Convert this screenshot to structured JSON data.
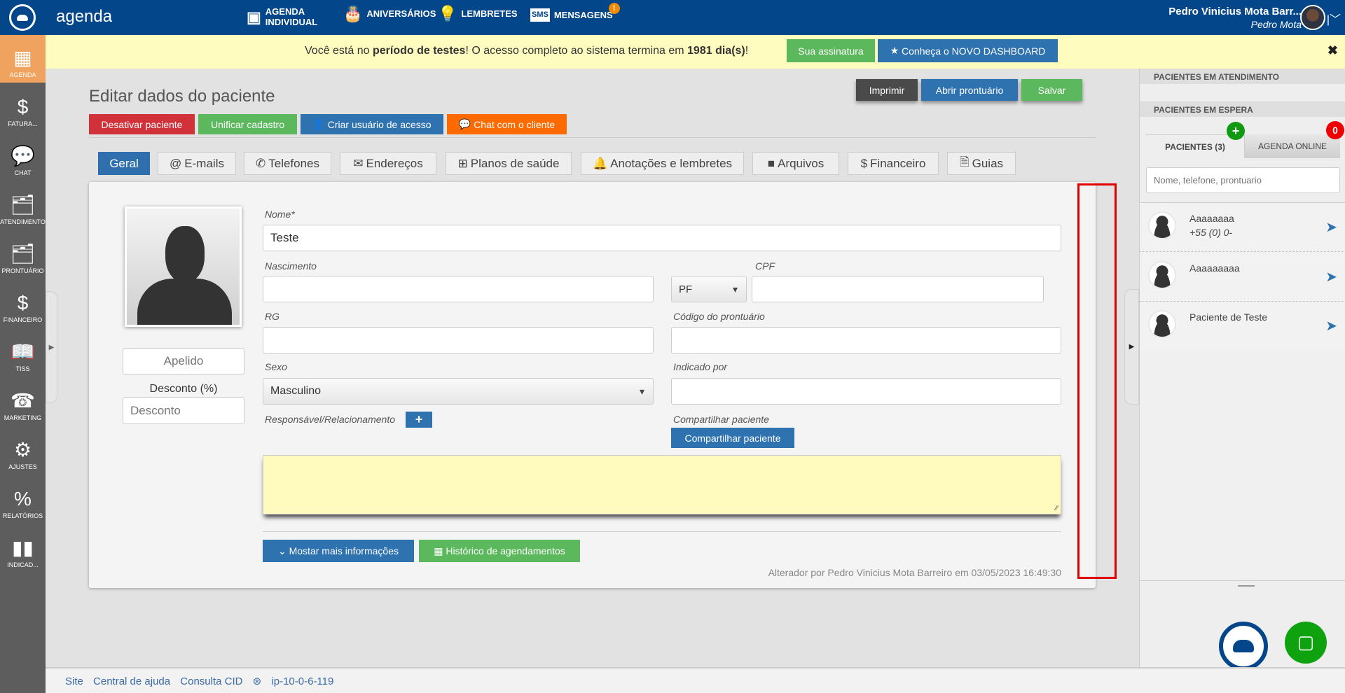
{
  "header": {
    "app_name": "agenda",
    "nav": [
      {
        "label": "AGENDA\nINDIVIDUAL",
        "icon": "calendar-card-icon"
      },
      {
        "label": "ANIVERSÁRIOS",
        "icon": "cake-icon"
      },
      {
        "label": "LEMBRETES",
        "icon": "lightbulb-icon"
      },
      {
        "label": "MENSAGENS",
        "icon": "sms-icon",
        "badge": "!"
      }
    ],
    "user_name": "Pedro Vinicius Mota Barr...",
    "user_short": "Pedro Mota"
  },
  "sidebar": {
    "items": [
      {
        "label": "AGENDA",
        "icon": "calendar-icon",
        "active": true
      },
      {
        "label": "FATURA...",
        "icon": "invoice-icon"
      },
      {
        "label": "CHAT",
        "icon": "chat-icon"
      },
      {
        "label": "ATENDIMENTO",
        "icon": "folder-check-icon"
      },
      {
        "label": "PRONTUÁRIO",
        "icon": "folder-check-icon"
      },
      {
        "label": "FINANCEIRO",
        "icon": "dollar-doc-icon"
      },
      {
        "label": "TISS",
        "icon": "book-icon"
      },
      {
        "label": "MARKETING",
        "icon": "phone-book-icon"
      },
      {
        "label": "AJUSTES",
        "icon": "gears-icon"
      },
      {
        "label": "RELATÓRIOS",
        "icon": "percent-doc-icon"
      },
      {
        "label": "INDICAD...",
        "icon": "bar-chart-icon"
      }
    ]
  },
  "banner": {
    "pre": "Você está no ",
    "bold1": "período de testes",
    "mid": "! O acesso completo ao sistema termina em ",
    "bold2": "1981 dia(s)",
    "post": "!",
    "subscription": "Sua assinatura",
    "dashboard": "Conheça o NOVO DASHBOARD"
  },
  "page": {
    "title": "Editar dados do paciente",
    "actions": {
      "deactivate": "Desativar paciente",
      "merge": "Unificar cadastro",
      "create_user": "Criar usuário de acesso",
      "chat": "Chat com o cliente"
    },
    "top": {
      "print": "Imprimir",
      "open_record": "Abrir prontuário",
      "save": "Salvar"
    },
    "tabs": [
      "Geral",
      "E-mails",
      "Telefones",
      "Endereços",
      "Planos de saúde",
      "Anotações e lembretes",
      "Arquivos",
      "Financeiro",
      "Guias"
    ]
  },
  "form": {
    "nickname_placeholder": "Apelido",
    "discount_label": "Desconto (%)",
    "discount_placeholder": "Desconto",
    "name_label": "Nome*",
    "name_value": "Teste",
    "birth_label": "Nascimento",
    "cpf_label": "CPF",
    "doc_type": "PF",
    "rg_label": "RG",
    "record_code_label": "Código do prontuário",
    "sex_label": "Sexo",
    "sex_value": "Masculino",
    "referred_label": "Indicado por",
    "responsible_label": "Responsável/Relacionamento",
    "share_label": "Compartilhar paciente",
    "share_button": "Compartilhar paciente",
    "more_info": "Mostar mais informações",
    "history": "Histórico de agendamentos",
    "altered_by": "Alterador por Pedro Vinicius Mota Barreiro em 03/05/2023 16:49:30"
  },
  "right_panel": {
    "in_service": "PACIENTES EM ATENDIMENTO",
    "waiting": "PACIENTES EM ESPERA",
    "tab_patients": "PACIENTES (3)",
    "tab_online": "AGENDA ONLINE",
    "online_count": "0",
    "search_placeholder": "Nome, telefone, prontuario",
    "patients": [
      {
        "name": "Aaaaaaaa",
        "phone": "+55 (0) 0-"
      },
      {
        "name": "Aaaaaaaaa",
        "phone": ""
      },
      {
        "name": "Paciente de Teste",
        "phone": ""
      }
    ]
  },
  "footer": {
    "links": [
      "Site",
      "Central de ajuda",
      "Consulta CID"
    ],
    "server": "ip-10-0-6-119"
  },
  "colors": {
    "header": "#03468a",
    "sidebar": "#5d5d5d",
    "active": "#f0a35e",
    "primary": "#2f72b0",
    "success": "#5cb85c",
    "danger": "#d1323a",
    "orange": "#ff6a00",
    "highlight_box": "#e00000"
  }
}
